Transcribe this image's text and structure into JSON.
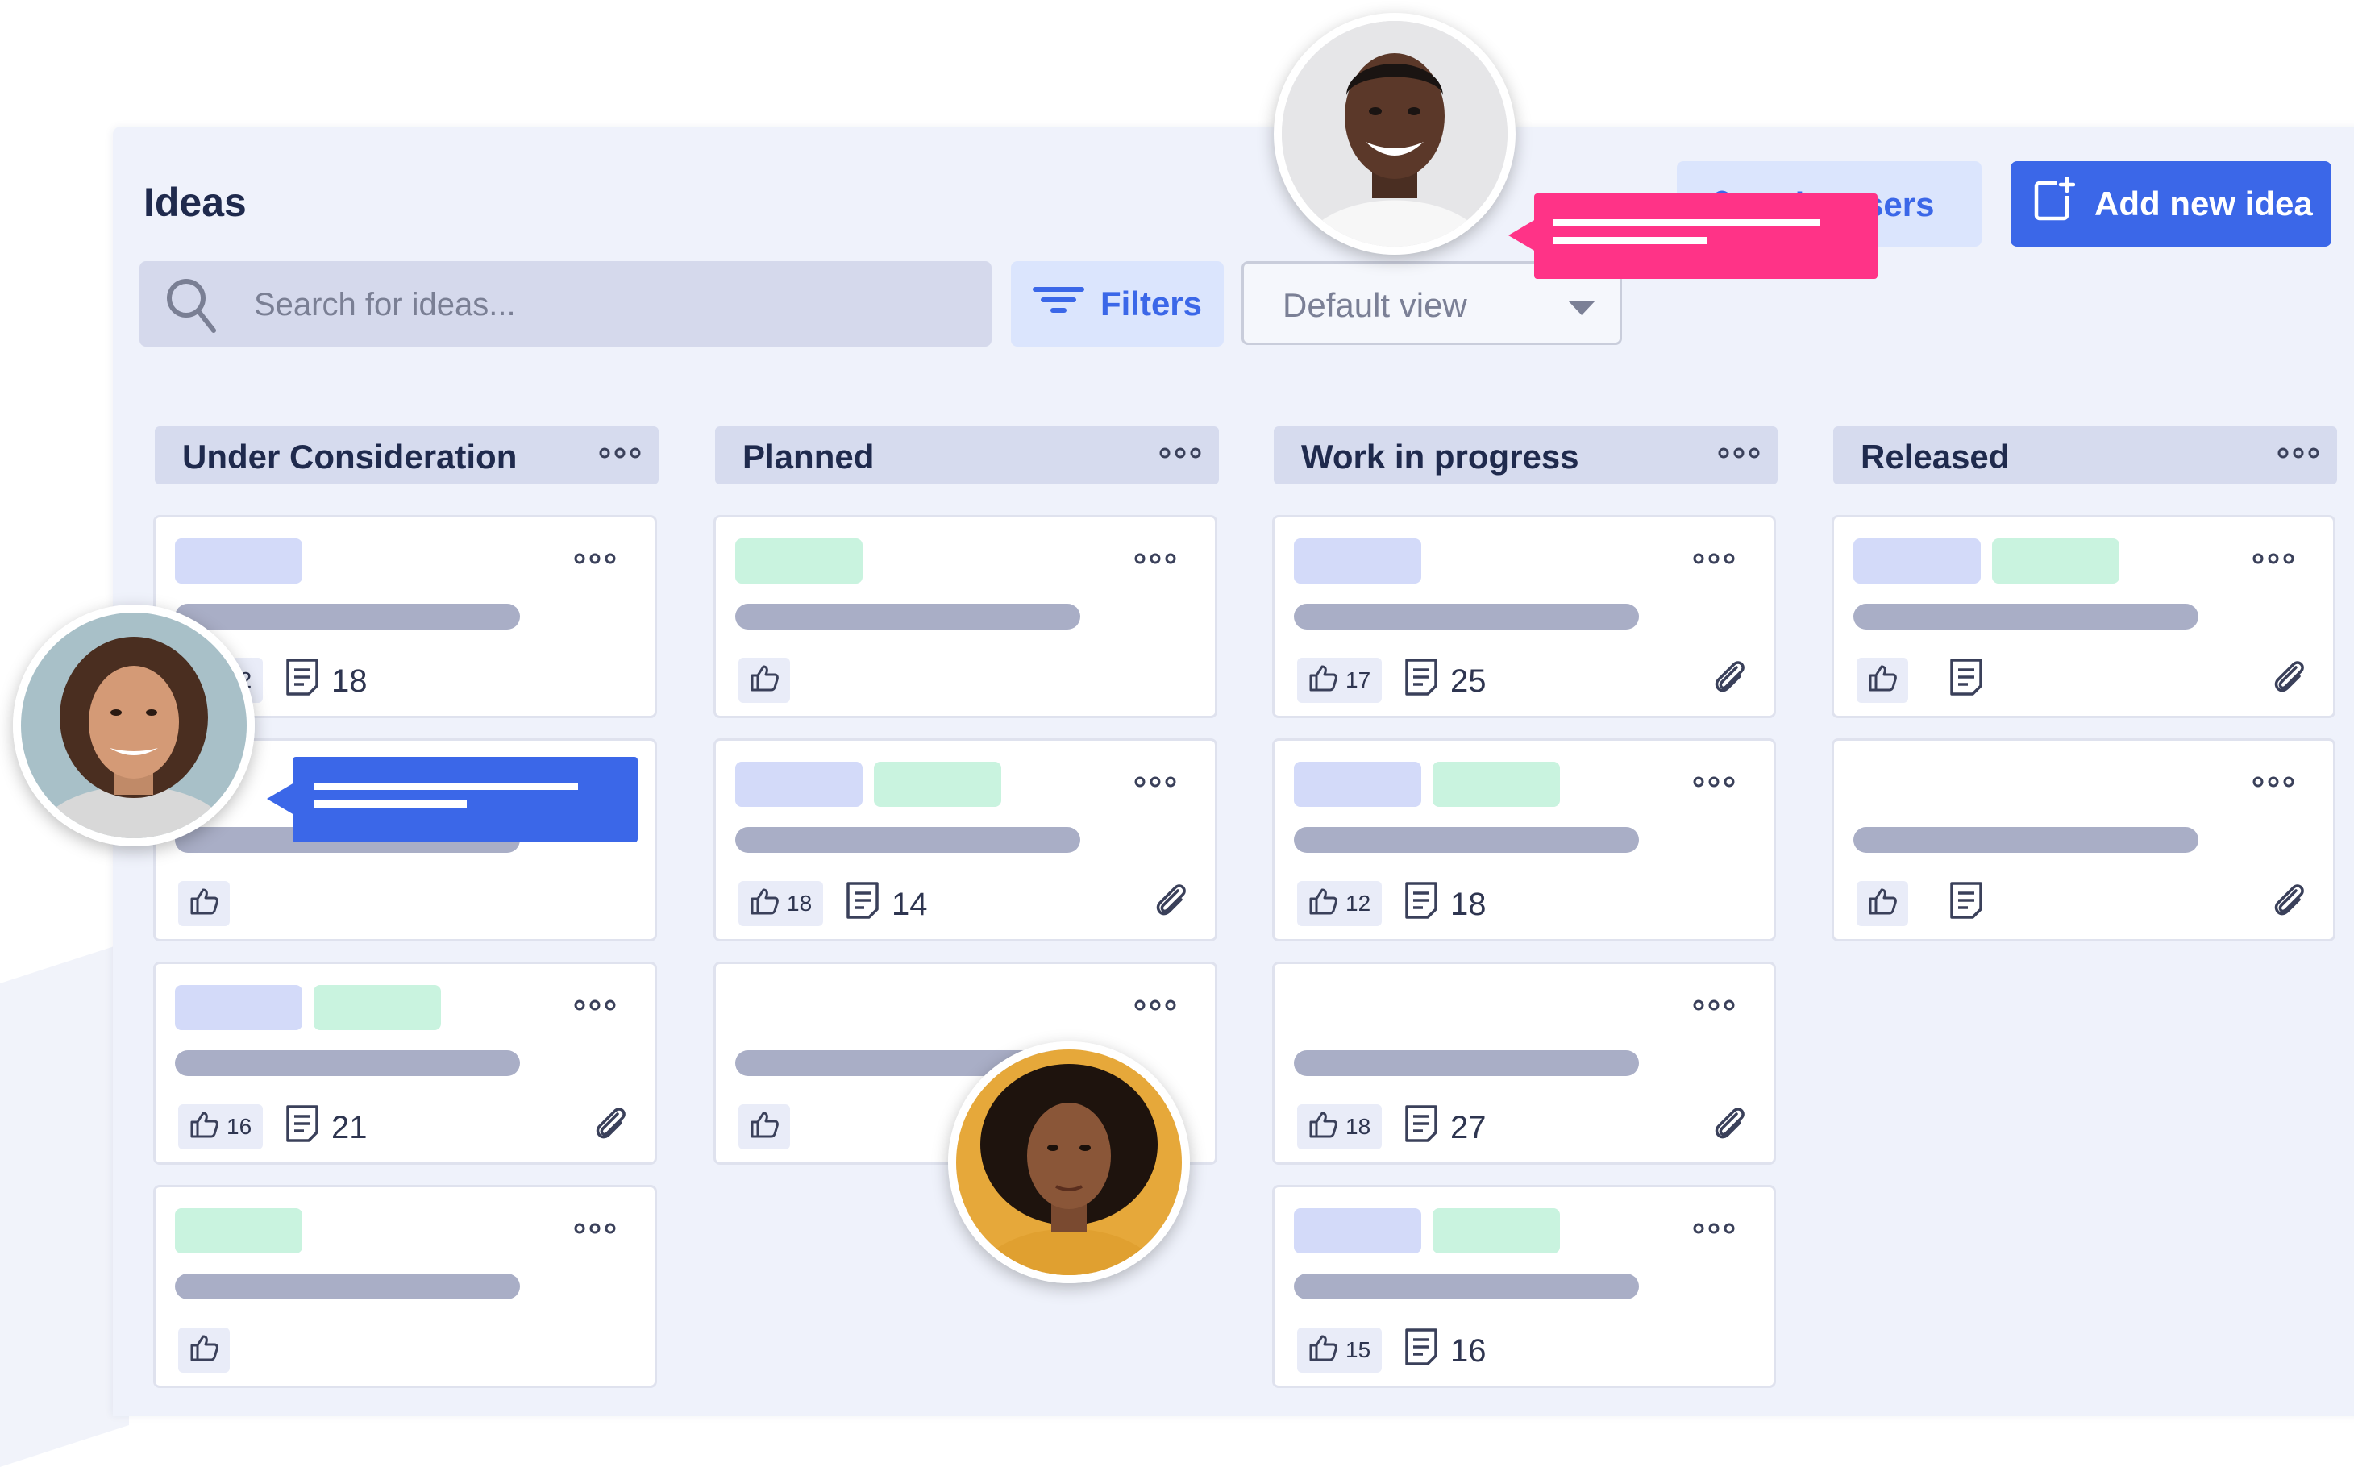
{
  "page": {
    "title": "Ideas"
  },
  "toolbar": {
    "search_placeholder": "Search for ideas...",
    "filters_label": "Filters",
    "view_selected": "Default view",
    "invite_label": "Invite users",
    "add_label": "Add new idea"
  },
  "colors": {
    "accent": "#3b67e8",
    "pink": "#ff3387",
    "tag_blue": "#d3daf9",
    "tag_green": "#c9f3df"
  },
  "columns": [
    {
      "name": "Under Consideration",
      "cards": [
        {
          "tags": [
            "blue"
          ],
          "likes": "12",
          "comments": "18",
          "attachment": false
        },
        {
          "tags": [],
          "likes": "",
          "comments": "",
          "attachment": false
        },
        {
          "tags": [
            "blue",
            "green"
          ],
          "likes": "16",
          "comments": "21",
          "attachment": true
        },
        {
          "tags": [
            "green"
          ],
          "likes": "",
          "comments": "",
          "attachment": false
        }
      ]
    },
    {
      "name": "Planned",
      "cards": [
        {
          "tags": [
            "green"
          ],
          "likes": "",
          "comments": "",
          "attachment": false
        },
        {
          "tags": [
            "blue",
            "green"
          ],
          "likes": "18",
          "comments": "14",
          "attachment": true
        },
        {
          "tags": [],
          "likes": "",
          "comments": "",
          "attachment": false
        }
      ]
    },
    {
      "name": "Work in progress",
      "cards": [
        {
          "tags": [
            "blue"
          ],
          "likes": "17",
          "comments": "25",
          "attachment": true
        },
        {
          "tags": [
            "blue",
            "green"
          ],
          "likes": "12",
          "comments": "18",
          "attachment": false
        },
        {
          "tags": [],
          "likes": "18",
          "comments": "27",
          "attachment": true
        },
        {
          "tags": [
            "blue",
            "green"
          ],
          "likes": "15",
          "comments": "16",
          "attachment": false
        }
      ]
    },
    {
      "name": "Released",
      "cards": [
        {
          "tags": [
            "blue",
            "green"
          ],
          "likes": "",
          "comments": "",
          "attachment": true,
          "comment_icon": true
        },
        {
          "tags": [],
          "likes": "",
          "comments": "",
          "attachment": true,
          "comment_icon": true
        }
      ]
    }
  ],
  "icons": {
    "more": "more-dots-icon",
    "like": "thumbs-up-icon",
    "comment": "comment-icon",
    "attachment": "paperclip-icon",
    "search": "search-icon",
    "filter": "filter-icon",
    "add": "add-idea-icon"
  }
}
